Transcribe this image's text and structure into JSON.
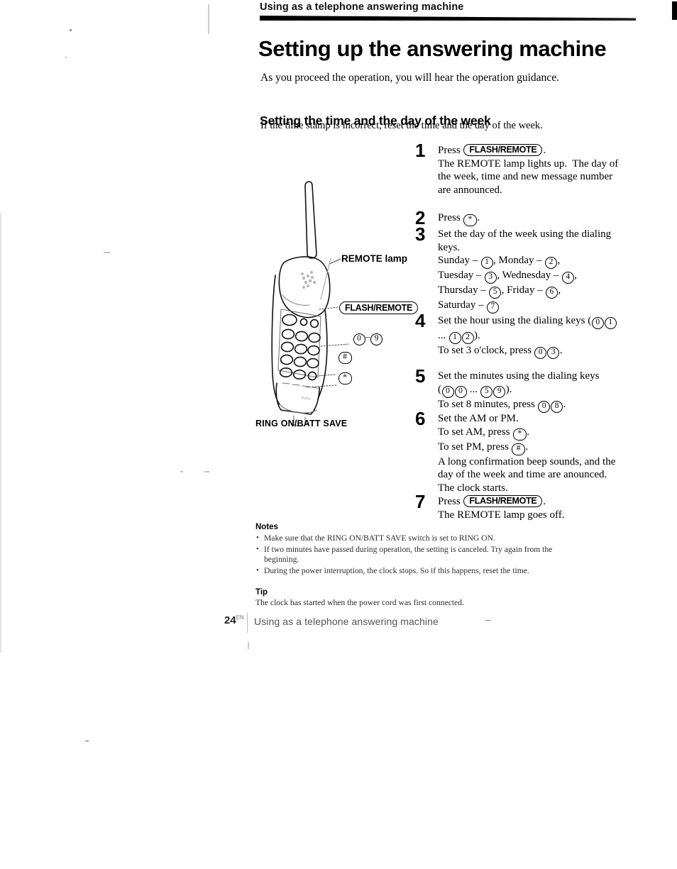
{
  "header": {
    "running_head": "Using as a telephone answering machine",
    "title": "Setting up the answering machine"
  },
  "intro": "As you proceed the operation, you will hear the operation guidance.",
  "section": {
    "title": "Setting the time and the day of the week",
    "subtitle": "If the time stamp is incorrect, reset the time and the day of the week."
  },
  "illustration": {
    "remote_lamp_label": "REMOTE lamp",
    "flash_remote_callout": "FLASH/REMOTE",
    "keys_callout_from": "0",
    "keys_callout_to": "9",
    "hash_callout": "#",
    "star_callout": "*",
    "ring_switch_label": "RING ON/BATT SAVE"
  },
  "steps": [
    {
      "num": "1",
      "lines": [
        "Press (FLASH/REMOTE).",
        "The REMOTE lamp lights up.  The day of",
        "the week, time and new message number",
        "are announced."
      ]
    },
    {
      "num": "2",
      "lines": [
        "Press (*)."
      ]
    },
    {
      "num": "3",
      "lines": [
        "Set the day of the week using the dialing",
        "keys.",
        "Sunday – (1), Monday – (2),",
        "Tuesday – (3), Wednesday – (4),",
        "Thursday – (5), Friday – (6),",
        "Saturday – (7)"
      ]
    },
    {
      "num": "4",
      "lines": [
        "Set the hour using the dialing keys ((0)(1)",
        "... (1)(2)).",
        "To set 3 o'clock, press (0)(3)."
      ]
    },
    {
      "num": "5",
      "lines": [
        "Set the minutes using the dialing keys",
        "((0)(0) ... (5)(9)).",
        "To set 8 minutes, press (0)(8)."
      ]
    },
    {
      "num": "6",
      "lines": [
        "Set the AM or PM.",
        "To set AM, press (*).",
        "To set PM, press (#).",
        "A long confirmation beep sounds, and the",
        "day of the week and time are anounced.",
        "The clock starts."
      ]
    },
    {
      "num": "7",
      "lines": [
        "Press (FLASH/REMOTE).",
        "The REMOTE lamp goes off."
      ]
    }
  ],
  "notes": {
    "heading": "Notes",
    "items": [
      "Make sure that the RING ON/BATT SAVE switch is set to RING ON.",
      "If two minutes have passed during operation, the setting is canceled. Try again from the beginning.",
      "During the power interruption, the clock stops.  So if this happens, reset the time."
    ]
  },
  "tip": {
    "heading": "Tip",
    "text": "The clock has started when the power cord was first connected."
  },
  "footer": {
    "page_number": "24",
    "page_number_sup": "EN",
    "text": "Using as a telephone answering machine"
  }
}
